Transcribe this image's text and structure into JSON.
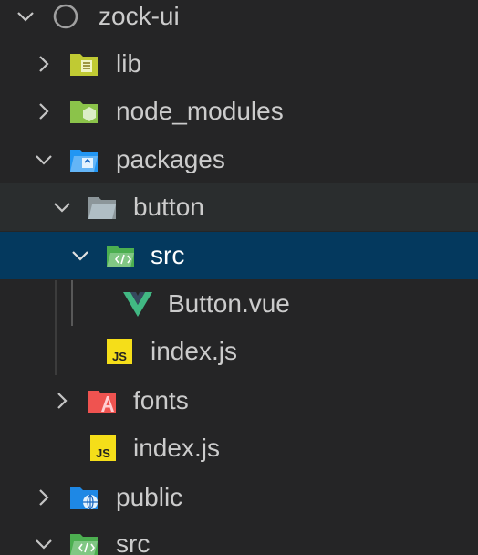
{
  "explorer": {
    "root": {
      "label": "zock-ui"
    },
    "items": [
      {
        "label": "lib",
        "state": "collapsed",
        "icon": "folder-lib-icon"
      },
      {
        "label": "node_modules",
        "state": "collapsed",
        "icon": "folder-node-icon"
      },
      {
        "label": "packages",
        "state": "expanded",
        "icon": "folder-packages-icon"
      },
      {
        "label": "button",
        "state": "expanded",
        "icon": "folder-open-icon"
      },
      {
        "label": "src",
        "state": "expanded",
        "selected": true,
        "icon": "folder-src-icon"
      },
      {
        "label": "Button.vue",
        "icon": "vue-icon"
      },
      {
        "label": "index.js",
        "icon": "js-icon"
      },
      {
        "label": "fonts",
        "state": "collapsed",
        "icon": "folder-fonts-icon"
      },
      {
        "label": "index.js",
        "icon": "js-icon"
      },
      {
        "label": "public",
        "state": "collapsed",
        "icon": "folder-public-icon"
      },
      {
        "label": "src",
        "state": "expanded",
        "icon": "folder-src-icon"
      }
    ]
  },
  "colors": {
    "background": "#252526",
    "selected_row": "#04395e",
    "hover_row": "#2a2d2e",
    "text": "#cccccc",
    "js": "#f5de19",
    "vue": "#41b883",
    "lib_folder": "#c0ca33",
    "node_folder": "#8bc34a",
    "packages_folder": "#2196f3",
    "src_folder": "#4caf50",
    "fonts_folder": "#ef5350",
    "public_folder": "#03a9f4"
  }
}
